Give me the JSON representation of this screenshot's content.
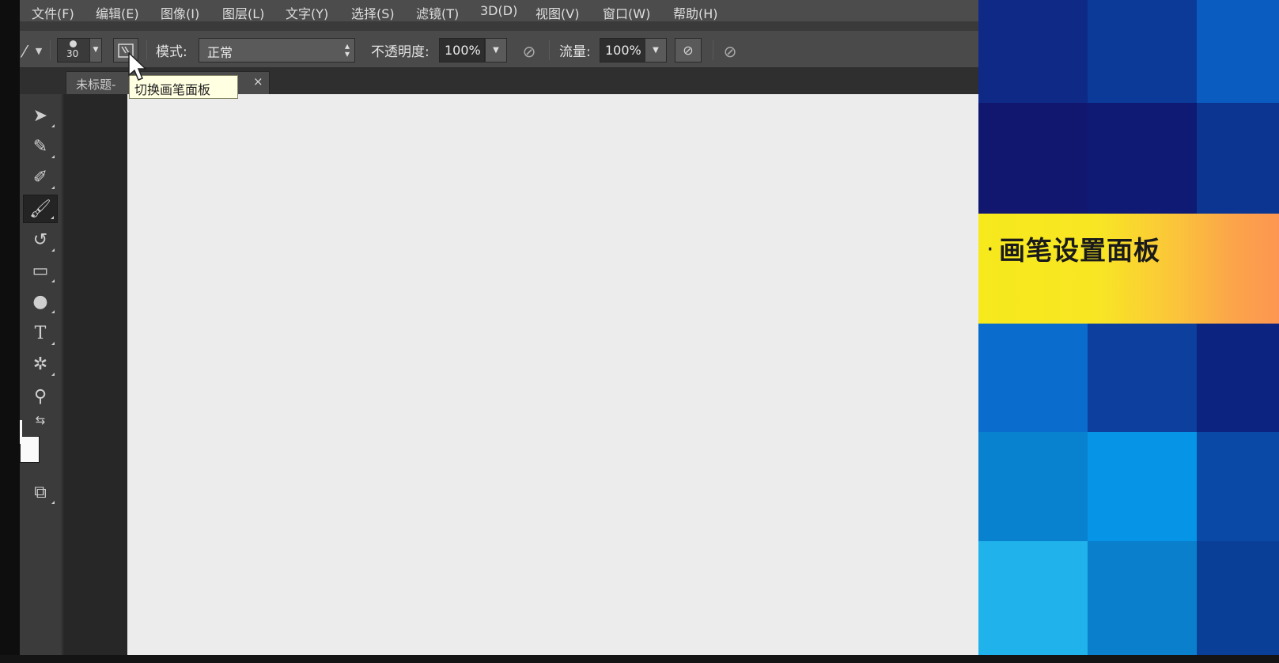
{
  "menu": [
    "文件(F)",
    "编辑(E)",
    "图像(I)",
    "图层(L)",
    "文字(Y)",
    "选择(S)",
    "滤镜(T)",
    "3D(D)",
    "视图(V)",
    "窗口(W)",
    "帮助(H)"
  ],
  "options_bar": {
    "brush_size": "30",
    "mode_label": "模式:",
    "mode_value": "正常",
    "opacity_label": "不透明度:",
    "opacity_value": "100%",
    "flow_label": "流量:",
    "flow_value": "100%"
  },
  "document_tab": {
    "name": "未标题-",
    "suffix": ")",
    "close": "×"
  },
  "tooltip": "切换画笔面板",
  "slide": {
    "bullet": "·",
    "title": "画笔设置面板"
  },
  "colors": {
    "canvas": "#ececec",
    "banner_yellow": "#f6e91c",
    "banner_orange": "#fd9652",
    "slide_blue_dark": "#0f1e78",
    "slide_blue_light": "#1fb0ea"
  },
  "icons": {
    "tools": [
      "move-icon",
      "quick-select-icon",
      "eyedropper-icon",
      "brush-icon",
      "history-brush-icon",
      "gradient-icon",
      "dodge-icon",
      "text-icon",
      "custom-shape-icon",
      "zoom-icon",
      "swap-colors-icon",
      "screen-mode-icon"
    ]
  }
}
